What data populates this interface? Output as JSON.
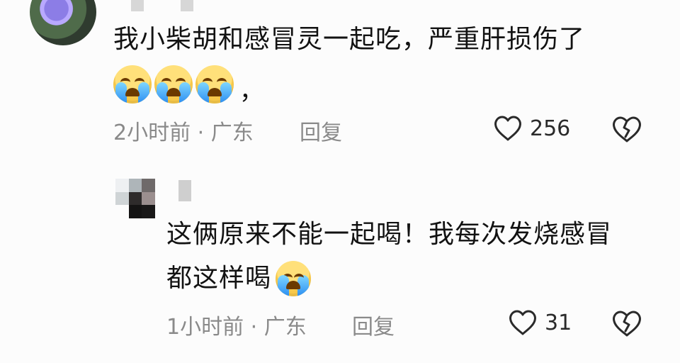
{
  "comments": [
    {
      "text": "我小柴胡和感冒灵一起吃，严重肝损伤了",
      "emoji_icons": [
        "loudly-crying-face-icon",
        "loudly-crying-face-icon",
        "loudly-crying-face-icon"
      ],
      "trailing_punctuation": "，",
      "meta": "2小时前 · 广东",
      "reply_label": "回复",
      "likes": "256"
    },
    {
      "text_line1": "这俩原来不能一起喝！我每次发烧感冒",
      "text_line2": "都这样喝",
      "emoji_icons": [
        "loudly-crying-face-icon"
      ],
      "meta": "1小时前 · 广东",
      "reply_label": "回复",
      "likes": "31"
    }
  ],
  "icons": {
    "like": "heart-outline-icon",
    "dislike": "broken-heart-outline-icon"
  },
  "colors": {
    "background": "#fcfcfc",
    "text_primary": "#121212",
    "text_secondary": "#8a8a8a",
    "icon": "#2a2a2a"
  }
}
